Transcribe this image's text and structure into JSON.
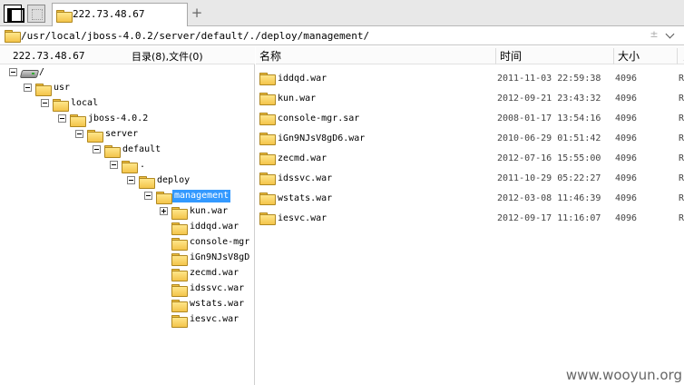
{
  "tabbar": {
    "tab_label": "222.73.48.67",
    "add_label": "+"
  },
  "address": {
    "path": "/usr/local/jboss-4.0.2/server/default/./deploy/management/",
    "sort_glyph": "±"
  },
  "left": {
    "host": "222.73.48.67",
    "count": "目录(8),文件(0)",
    "tree": [
      {
        "label": "/",
        "kind": "drive",
        "expander": "minus"
      },
      {
        "label": "usr",
        "kind": "folder",
        "expander": "minus"
      },
      {
        "label": "local",
        "kind": "folder",
        "expander": "minus"
      },
      {
        "label": "jboss-4.0.2",
        "kind": "folder",
        "expander": "minus"
      },
      {
        "label": "server",
        "kind": "folder",
        "expander": "minus"
      },
      {
        "label": "default",
        "kind": "folder",
        "expander": "minus"
      },
      {
        "label": ".",
        "kind": "folder",
        "expander": "minus"
      },
      {
        "label": "deploy",
        "kind": "folder",
        "expander": "minus"
      },
      {
        "label": "management",
        "kind": "folder",
        "expander": "minus",
        "selected": true
      },
      {
        "label": "kun.war",
        "kind": "folder",
        "expander": "plus"
      },
      {
        "label": "iddqd.war",
        "kind": "folder",
        "expander": "none"
      },
      {
        "label": "console-mgr",
        "kind": "folder",
        "expander": "none"
      },
      {
        "label": "iGn9NJsV8gD",
        "kind": "folder",
        "expander": "none"
      },
      {
        "label": "zecmd.war",
        "kind": "folder",
        "expander": "none"
      },
      {
        "label": "idssvc.war",
        "kind": "folder",
        "expander": "none"
      },
      {
        "label": "wstats.war",
        "kind": "folder",
        "expander": "none"
      },
      {
        "label": "iesvc.war",
        "kind": "folder",
        "expander": "none"
      }
    ]
  },
  "columns": {
    "name": "名称",
    "time": "时间",
    "size": "大小",
    "extra": "丿"
  },
  "files": [
    {
      "name": "iddqd.war",
      "time": "2011-11-03 22:59:38",
      "size": "4096",
      "extra": "R"
    },
    {
      "name": "kun.war",
      "time": "2012-09-21 23:43:32",
      "size": "4096",
      "extra": "R"
    },
    {
      "name": "console-mgr.sar",
      "time": "2008-01-17 13:54:16",
      "size": "4096",
      "extra": "R"
    },
    {
      "name": "iGn9NJsV8gD6.war",
      "time": "2010-06-29 01:51:42",
      "size": "4096",
      "extra": "R"
    },
    {
      "name": "zecmd.war",
      "time": "2012-07-16 15:55:00",
      "size": "4096",
      "extra": "R"
    },
    {
      "name": "idssvc.war",
      "time": "2011-10-29 05:22:27",
      "size": "4096",
      "extra": "R"
    },
    {
      "name": "wstats.war",
      "time": "2012-03-08 11:46:39",
      "size": "4096",
      "extra": "R"
    },
    {
      "name": "iesvc.war",
      "time": "2012-09-17 11:16:07",
      "size": "4096",
      "extra": "R"
    }
  ],
  "watermark": "www.wooyun.org"
}
